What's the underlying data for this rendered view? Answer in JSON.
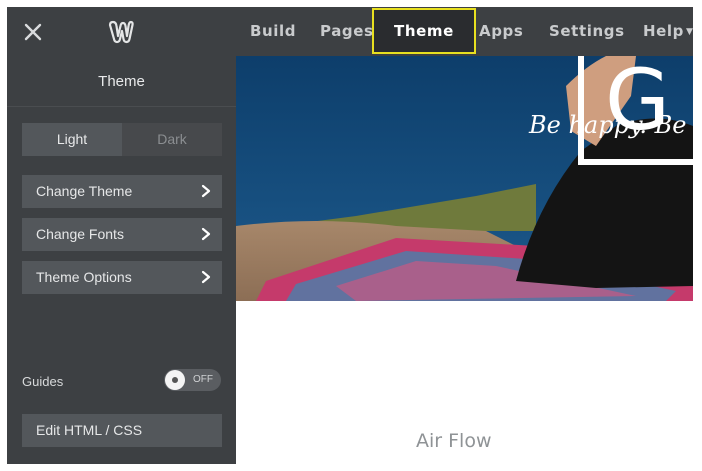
{
  "nav": {
    "build": "Build",
    "pages": "Pages",
    "theme": "Theme",
    "apps": "Apps",
    "settings": "Settings",
    "help": "Help"
  },
  "icons": {
    "close": "close-icon",
    "logo": "weebly-logo-icon",
    "chevron": "chevron-right-icon",
    "help_caret": "caret-down-icon"
  },
  "sidebar": {
    "title": "Theme",
    "segment": {
      "light": "Light",
      "dark": "Dark",
      "selected": "Light"
    },
    "menu": {
      "change_theme": "Change Theme",
      "change_fonts": "Change Fonts",
      "theme_options": "Theme Options"
    },
    "guides": {
      "label": "Guides",
      "state": "OFF"
    },
    "edit_html": "Edit HTML / CSS"
  },
  "preview": {
    "headline": "Be happy. Be hea",
    "logo_letter": "G",
    "site_name": "Air Flow"
  },
  "colors": {
    "toolbar_bg": "#3d4043",
    "active_tab_bg": "#2a2c2f",
    "highlight": "#e8e020",
    "button_bg": "#53575b"
  }
}
